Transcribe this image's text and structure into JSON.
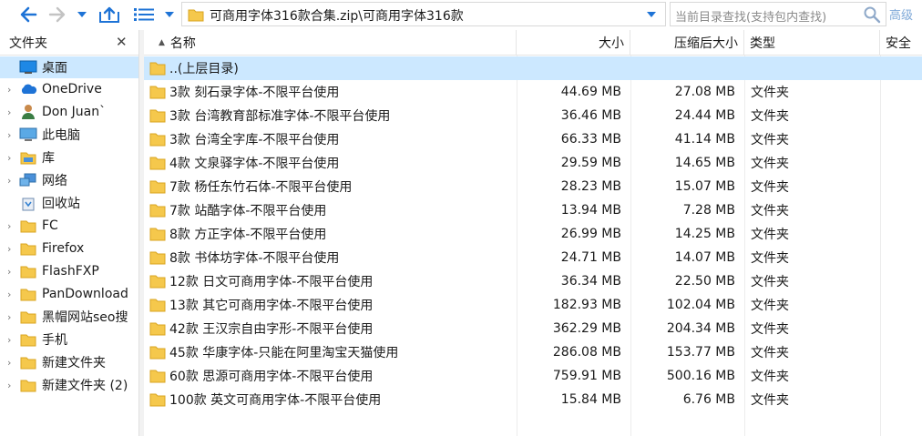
{
  "toolbar": {
    "address_path": "可商用字体316款合集.zip\\可商用字体316款",
    "search_placeholder": "当前目录查找(支持包内查找)",
    "advanced_label": "高级"
  },
  "left_pane": {
    "title": "文件夹",
    "close_glyph": "✕",
    "items": [
      {
        "label": "桌面",
        "icon": "desktop-icon",
        "arrow": ""
      },
      {
        "label": "OneDrive",
        "icon": "cloud-icon",
        "arrow": "›"
      },
      {
        "label": "Don Juan`",
        "icon": "user-icon",
        "arrow": "›"
      },
      {
        "label": "此电脑",
        "icon": "computer-icon",
        "arrow": "›"
      },
      {
        "label": "库",
        "icon": "library-icon",
        "arrow": "›"
      },
      {
        "label": "网络",
        "icon": "network-icon",
        "arrow": "›"
      },
      {
        "label": "回收站",
        "icon": "recycle-bin-icon",
        "arrow": ""
      },
      {
        "label": "FC",
        "icon": "folder-icon",
        "arrow": "›"
      },
      {
        "label": "Firefox",
        "icon": "folder-icon",
        "arrow": "›"
      },
      {
        "label": "FlashFXP",
        "icon": "folder-icon",
        "arrow": "›"
      },
      {
        "label": "PanDownload",
        "icon": "folder-icon",
        "arrow": "›"
      },
      {
        "label": "黑帽网站seo搜",
        "icon": "folder-icon",
        "arrow": "›"
      },
      {
        "label": "手机",
        "icon": "folder-icon",
        "arrow": "›"
      },
      {
        "label": "新建文件夹",
        "icon": "folder-icon",
        "arrow": "›"
      },
      {
        "label": "新建文件夹 (2)",
        "icon": "folder-icon",
        "arrow": "›"
      }
    ]
  },
  "file_list": {
    "columns": {
      "name": "名称",
      "size": "大小",
      "compressed": "压缩后大小",
      "type": "类型",
      "security": "安全"
    },
    "sort_glyph": "▲",
    "rows": [
      {
        "name": "..(上层目录)",
        "size": "",
        "compressed": "",
        "type": ""
      },
      {
        "name": "3款 刻石录字体-不限平台使用",
        "size": "44.69 MB",
        "compressed": "27.08 MB",
        "type": "文件夹"
      },
      {
        "name": "3款 台湾教育部标准字体-不限平台使用",
        "size": "36.46 MB",
        "compressed": "24.44 MB",
        "type": "文件夹"
      },
      {
        "name": "3款 台湾全字库-不限平台使用",
        "size": "66.33 MB",
        "compressed": "41.14 MB",
        "type": "文件夹"
      },
      {
        "name": "4款 文泉驿字体-不限平台使用",
        "size": "29.59 MB",
        "compressed": "14.65 MB",
        "type": "文件夹"
      },
      {
        "name": "7款 杨任东竹石体-不限平台使用",
        "size": "28.23 MB",
        "compressed": "15.07 MB",
        "type": "文件夹"
      },
      {
        "name": "7款 站酷字体-不限平台使用",
        "size": "13.94 MB",
        "compressed": "7.28 MB",
        "type": "文件夹"
      },
      {
        "name": "8款 方正字体-不限平台使用",
        "size": "26.99 MB",
        "compressed": "14.25 MB",
        "type": "文件夹"
      },
      {
        "name": "8款 书体坊字体-不限平台使用",
        "size": "24.71 MB",
        "compressed": "14.07 MB",
        "type": "文件夹"
      },
      {
        "name": "12款 日文可商用字体-不限平台使用",
        "size": "36.34 MB",
        "compressed": "22.50 MB",
        "type": "文件夹"
      },
      {
        "name": "13款 其它可商用字体-不限平台使用",
        "size": "182.93 MB",
        "compressed": "102.04 MB",
        "type": "文件夹"
      },
      {
        "name": "42款 王汉宗自由字形-不限平台使用",
        "size": "362.29 MB",
        "compressed": "204.34 MB",
        "type": "文件夹"
      },
      {
        "name": "45款 华康字体-只能在阿里淘宝天猫使用",
        "size": "286.08 MB",
        "compressed": "153.77 MB",
        "type": "文件夹"
      },
      {
        "name": "60款 思源可商用字体-不限平台使用",
        "size": "759.91 MB",
        "compressed": "500.16 MB",
        "type": "文件夹"
      },
      {
        "name": "100款 英文可商用字体-不限平台使用",
        "size": "15.84 MB",
        "compressed": "6.76 MB",
        "type": "文件夹"
      }
    ]
  },
  "colors": {
    "selection": "#cce8ff",
    "accent_blue": "#1e73d6",
    "folder_yellow": "#f5c84c"
  }
}
